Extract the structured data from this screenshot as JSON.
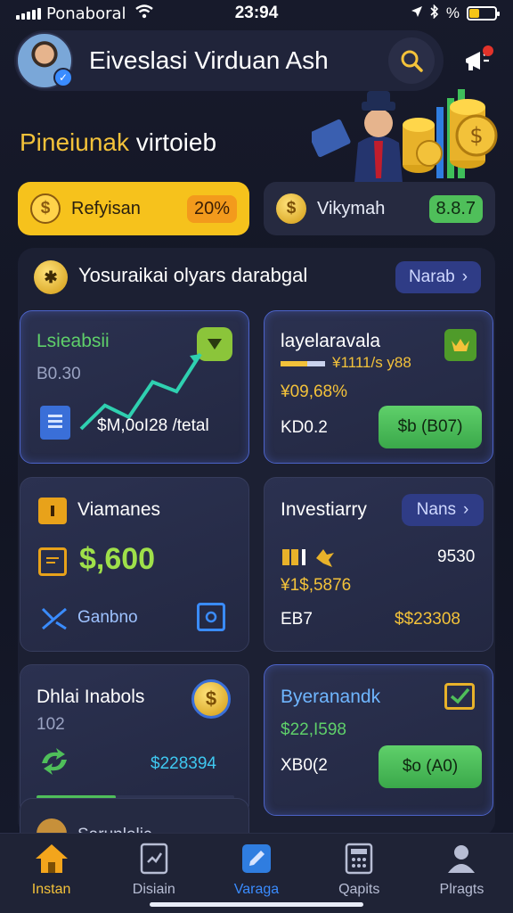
{
  "status_bar": {
    "carrier": "Ponaboral",
    "time": "23:94",
    "battery_text": "%"
  },
  "header": {
    "title": "Eiveslasi Virduan Ash"
  },
  "hero": {
    "title_yellow": "Pineiunak",
    "title_white": "virtoieb"
  },
  "pills": [
    {
      "label": "Refyisan",
      "badge": "20%",
      "badge_color": "#f39a1c"
    },
    {
      "label": "Vikymah",
      "badge": "8.8.7",
      "badge_color": "#4fbf5a"
    }
  ],
  "section": {
    "title": "Yosuraikai olyars darabgal",
    "link": "Narab"
  },
  "cards": {
    "c1": {
      "title": "Lsieabsii",
      "sub": "B0.30",
      "amount": "$M,0oI28 /tetal",
      "chart_values": [
        1,
        2,
        1.5,
        3,
        2.6,
        4.2
      ]
    },
    "c2": {
      "title": "layelaravala",
      "line1": "¥1111/s y88",
      "line2": "¥09,68%",
      "code": "KD0.2",
      "button": "$b (B07)"
    },
    "c3": {
      "title": "Viamanes",
      "amount": "$,600",
      "footer": "Ganbno"
    },
    "c4": {
      "title": "Investiarry",
      "chip": "Nans",
      "val_right": "9530",
      "val2": "¥1$,5876",
      "code": "EB7",
      "amount": "$$23308"
    },
    "c5": {
      "title": "Dhlai Inabols",
      "sub": "102",
      "amount": "$228394",
      "progress": 0.4
    },
    "c6": {
      "title": "Byeranandk",
      "amount": "$22,I598",
      "code": "XB0(2",
      "button": "$o (A0)"
    },
    "c7": {
      "title": "Sarunlolic"
    }
  },
  "bottom_nav": [
    {
      "label": "Instan",
      "icon": "home-icon"
    },
    {
      "label": "Disiain",
      "icon": "document-icon"
    },
    {
      "label": "Varaga",
      "icon": "edit-icon"
    },
    {
      "label": "Qapits",
      "icon": "calculator-icon"
    },
    {
      "label": "Plragts",
      "icon": "profile-icon"
    }
  ],
  "colors": {
    "accent_yellow": "#f6c21c",
    "accent_blue": "#3a8cff",
    "accent_green": "#4fbf5a",
    "background": "#141726"
  }
}
